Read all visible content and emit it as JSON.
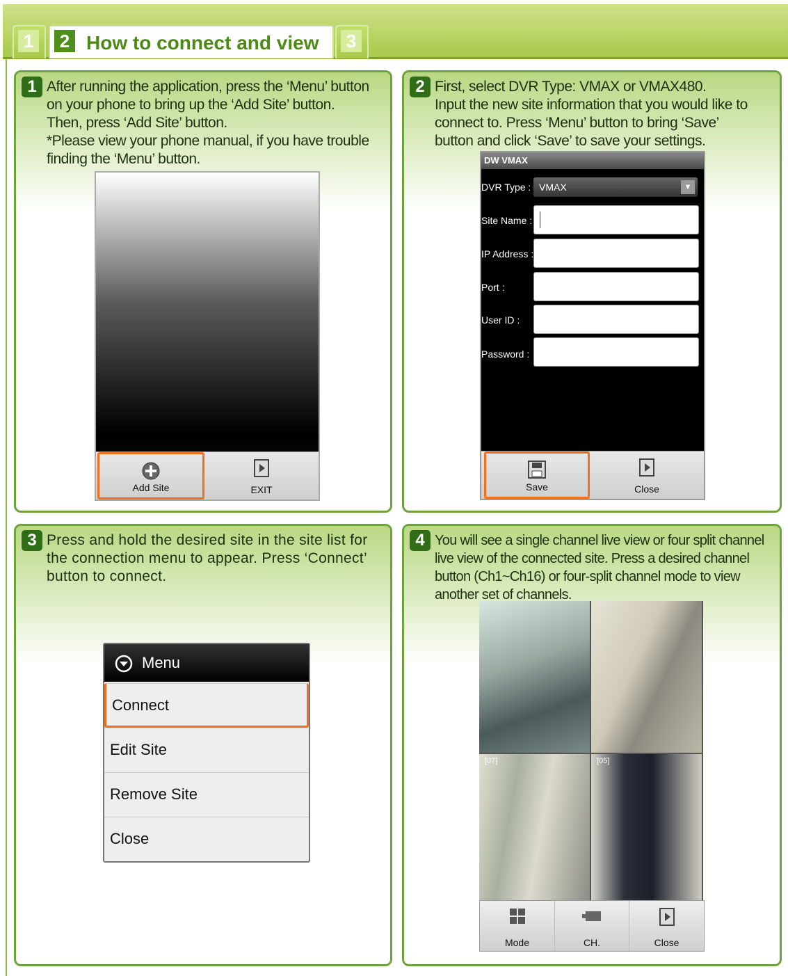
{
  "header": {
    "tabs": [
      {
        "num": "1"
      },
      {
        "num": "2",
        "title": "How to connect and view"
      },
      {
        "num": "3"
      }
    ]
  },
  "steps": [
    {
      "num": "1",
      "text": "After running the application, press the ‘Menu’ button\non your phone to bring up the ‘Add Site’ button.\nThen, press ‘Add Site’ button.\n*Please view your phone manual, if you have trouble\n   finding the ‘Menu’ button.",
      "buttons": {
        "add_site": "Add Site",
        "exit": "EXIT"
      }
    },
    {
      "num": "2",
      "text": "First, select DVR Type: VMAX or VMAX480.\nInput the new site information that you would like to\nconnect to. Press ‘Menu’ button to bring ‘Save’\nbutton and click ‘Save’ to save your settings.",
      "form": {
        "title": "DW VMAX",
        "dvr_type_label": "DVR Type :",
        "dvr_type_value": "VMAX",
        "site_name_label": "Site Name :",
        "ip_label": "IP Address :",
        "port_label": "Port :",
        "user_label": "User ID :",
        "password_label": "Password :"
      },
      "buttons": {
        "save": "Save",
        "close": "Close"
      }
    },
    {
      "num": "3",
      "text": "Press and hold the desired site in the site list for\nthe connection menu to appear. Press ‘Connect’\nbutton to connect.",
      "menu": {
        "title": "Menu",
        "items": [
          "Connect",
          "Edit Site",
          "Remove Site",
          "Close"
        ]
      }
    },
    {
      "num": "4",
      "text": "You will see a single channel live view or four split channel\nlive view of the connected site. Press a desired channel\nbutton (Ch1~Ch16) or four-split channel mode to view\nanother set of channels.",
      "buttons": {
        "mode": "Mode",
        "ch": "CH.",
        "close": "Close"
      },
      "channel_tags": [
        "[07]",
        "[05]"
      ]
    }
  ],
  "colors": {
    "accent": "#4f8e1a",
    "highlight": "#f07020",
    "panel_border": "#6ea23a"
  }
}
